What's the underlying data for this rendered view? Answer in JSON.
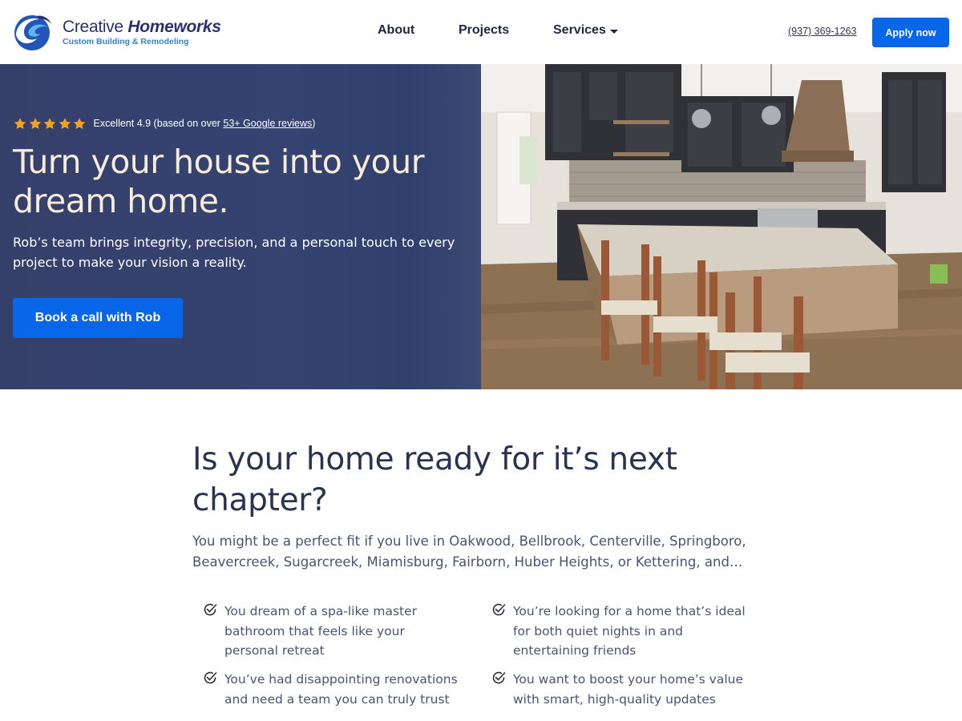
{
  "header": {
    "logo_name_plain": "Creative",
    "logo_name_italic": "Homeworks",
    "logo_tagline": "Custom Building & Remodeling",
    "nav": {
      "about": "About",
      "projects": "Projects",
      "services": "Services"
    },
    "phone": "(937) 369-1263",
    "apply_label": "Apply now"
  },
  "hero": {
    "rating_prefix": "Excellent 4.9 (based on over ",
    "rating_link": "53+ Google reviews",
    "rating_suffix": ")",
    "stars": 5,
    "title": "Turn your house into your dream home.",
    "subtitle": "Rob’s team brings integrity, precision, and a personal touch to every project to make your vision a reality.",
    "cta_label": "Book a call with Rob"
  },
  "section": {
    "title": "Is your home ready for it’s next chapter?",
    "lead": "You might be a perfect fit if you live in Oakwood, Bellbrook, Centerville, Springboro, Beavercreek, Sugarcreek, Miamisburg, Fairborn, Huber Heights, or Kettering, and…",
    "checks": [
      "You dream of a spa-like master bathroom that feels like your personal retreat",
      "You’re looking for a home that’s ideal for both quiet nights in and entertaining friends",
      "You’ve had disappointing renovations and need a team you can truly trust",
      "You want to boost your home’s value with smart, high-quality updates"
    ]
  },
  "colors": {
    "brand_blue": "#0a66e8",
    "hero_bg": "#354371",
    "hero_title": "#f6ecd9",
    "star": "#f4a11d"
  }
}
